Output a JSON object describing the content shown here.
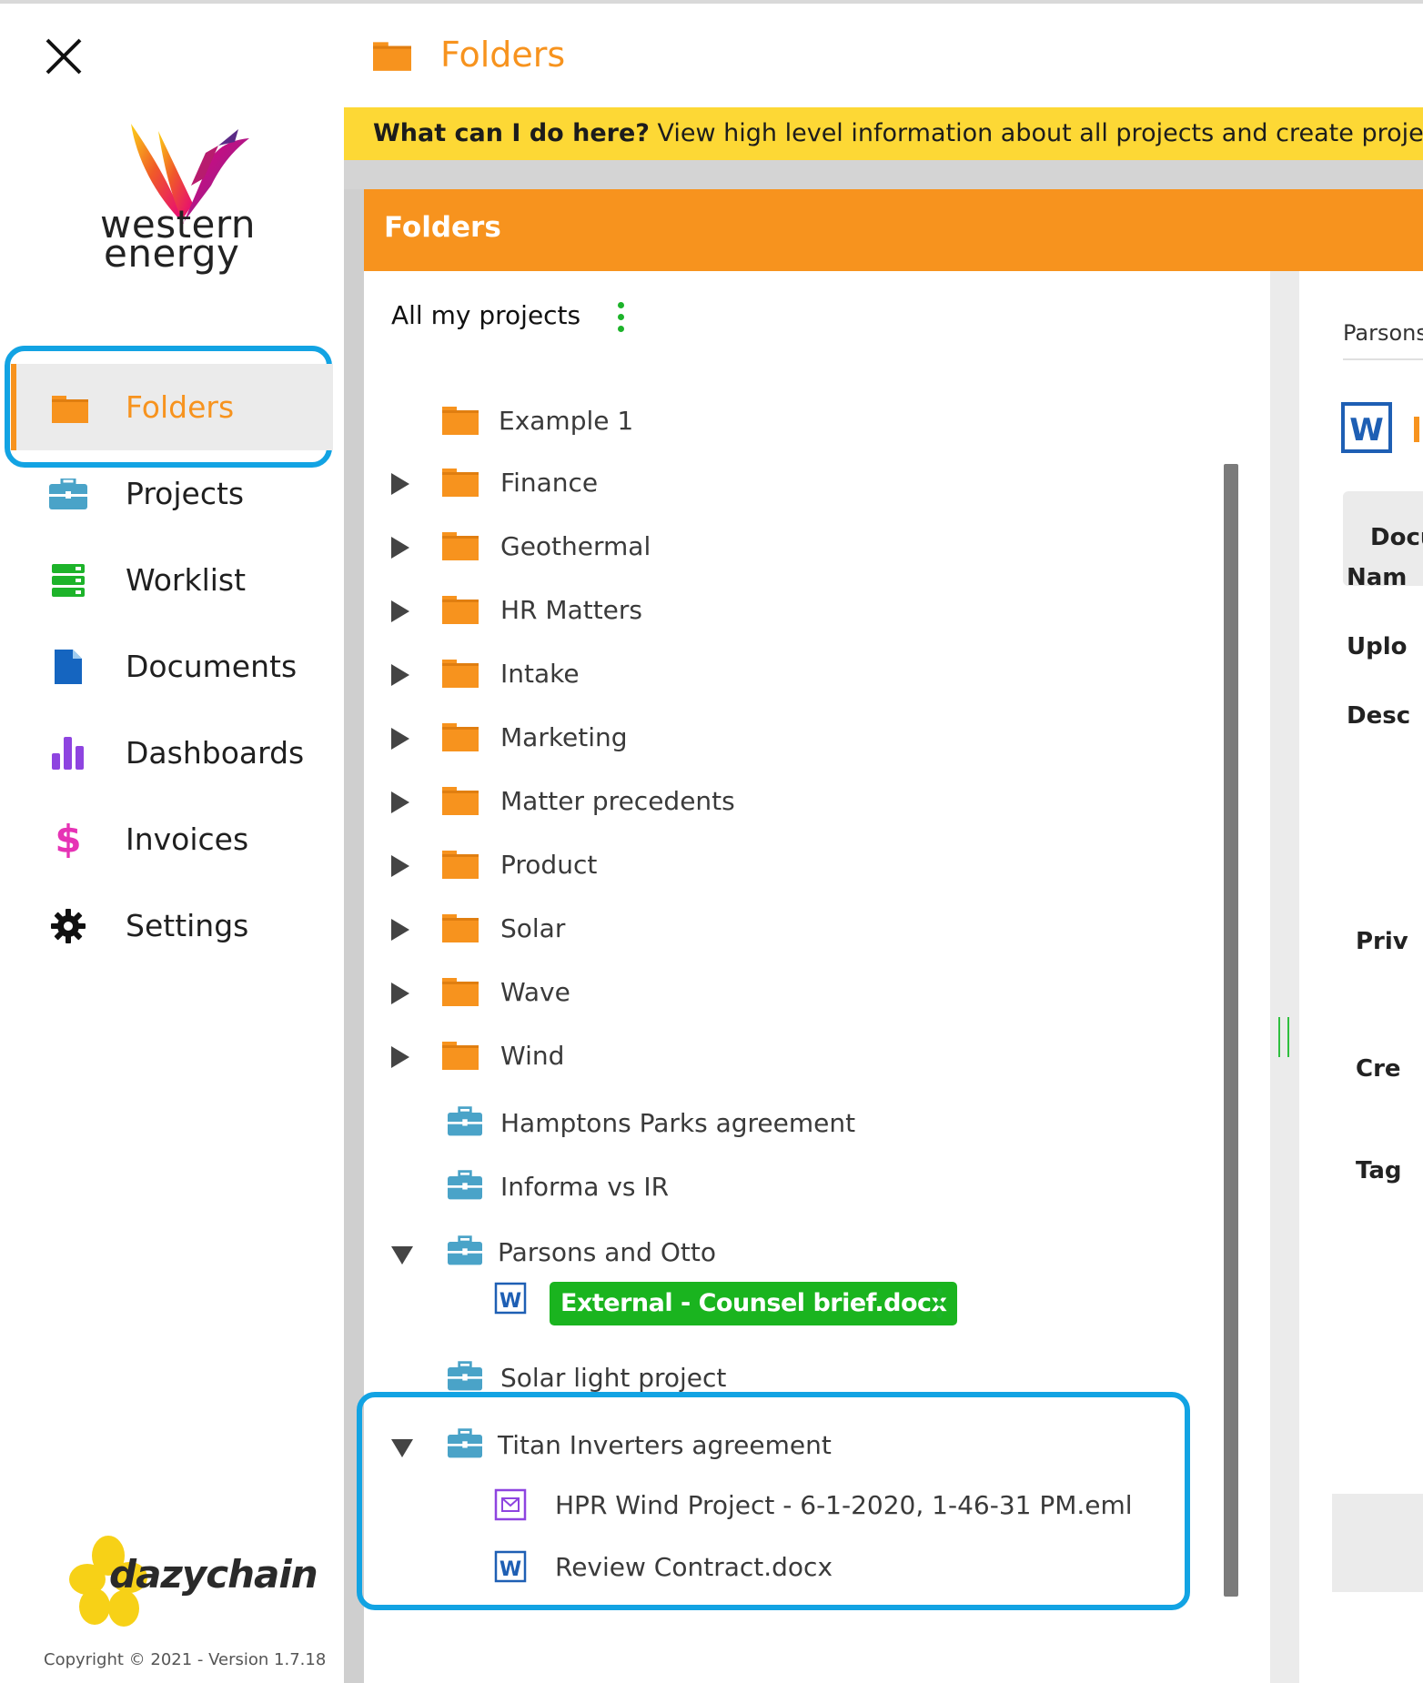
{
  "app": {
    "brand_logo_line1": "western",
    "brand_logo_line2": "energy",
    "vendor_logo": "dazychain",
    "copyright": "Copyright © 2021 - Version 1.7.18",
    "close_icon": "close-icon"
  },
  "sidebar": {
    "items": [
      {
        "label": "Folders",
        "icon": "folder-icon",
        "color": "#f7931e",
        "active": true
      },
      {
        "label": "Projects",
        "icon": "briefcase-icon",
        "color": "#4aa3c8"
      },
      {
        "label": "Worklist",
        "icon": "worklist-icon",
        "color": "#1db32a"
      },
      {
        "label": "Documents",
        "icon": "document-icon",
        "color": "#1565c0"
      },
      {
        "label": "Dashboards",
        "icon": "bar-chart-icon",
        "color": "#8e44e0"
      },
      {
        "label": "Invoices",
        "icon": "dollar-icon",
        "color": "#e633b5"
      },
      {
        "label": "Settings",
        "icon": "gear-icon",
        "color": "#111111"
      }
    ]
  },
  "header": {
    "title": "Folders"
  },
  "help": {
    "question": "What can I do here?",
    "text": " View high level information about all projects and create projects. To sta"
  },
  "panel": {
    "title": "Folders",
    "root_label": "All my projects",
    "tree": [
      {
        "label": "Example 1",
        "type": "folder",
        "caret": "none"
      },
      {
        "label": "Finance",
        "type": "folder",
        "caret": "right"
      },
      {
        "label": "Geothermal",
        "type": "folder",
        "caret": "right"
      },
      {
        "label": "HR Matters",
        "type": "folder",
        "caret": "right"
      },
      {
        "label": "Intake",
        "type": "folder",
        "caret": "right"
      },
      {
        "label": "Marketing",
        "type": "folder",
        "caret": "right"
      },
      {
        "label": "Matter precedents",
        "type": "folder",
        "caret": "right"
      },
      {
        "label": "Product",
        "type": "folder",
        "caret": "right"
      },
      {
        "label": "Solar",
        "type": "folder",
        "caret": "right"
      },
      {
        "label": "Wave",
        "type": "folder",
        "caret": "right"
      },
      {
        "label": "Wind",
        "type": "folder",
        "caret": "right"
      },
      {
        "label": "Hamptons Parks agreement",
        "type": "project",
        "caret": "none"
      },
      {
        "label": "Informa vs IR",
        "type": "project",
        "caret": "none"
      },
      {
        "label": "Parsons and Otto",
        "type": "project",
        "caret": "down"
      },
      {
        "label": "External - Counsel brief.docx",
        "type": "word-doc",
        "selected": true
      },
      {
        "label": "Solar light project",
        "type": "project",
        "caret": "none"
      },
      {
        "label": "Titan Inverters agreement",
        "type": "project",
        "caret": "down"
      },
      {
        "label": "HPR Wind Project - 6-1-2020, 1-46-31 PM.eml",
        "type": "email"
      },
      {
        "label": "Review Contract.docx",
        "type": "word-doc"
      }
    ]
  },
  "details": {
    "breadcrumb": "Parsons",
    "tab": "Docu",
    "fields": [
      "Nam",
      "Uplo",
      "Desc",
      "Priv",
      "Cre",
      "Tag"
    ]
  },
  "colors": {
    "accent": "#f7931e",
    "help_bar": "#fdd835",
    "highlight": "#12a3e3",
    "selected_doc": "#1ab41f"
  }
}
